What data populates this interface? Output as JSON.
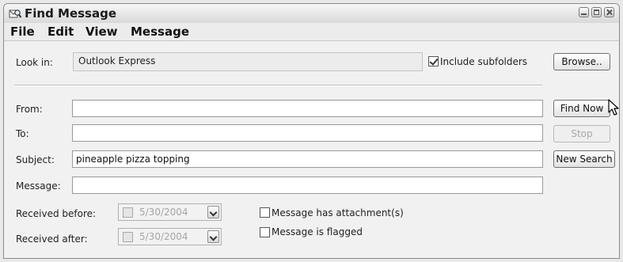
{
  "window": {
    "title": "Find Message",
    "icon": "find-message-icon"
  },
  "menu": [
    "File",
    "Edit",
    "View",
    "Message"
  ],
  "look_in": {
    "label": "Look in:",
    "value": "Outlook Express"
  },
  "include_subfolders": {
    "label": "Include subfolders",
    "checked": true
  },
  "buttons": {
    "browse": "Browse..",
    "find_now": "Find Now",
    "stop": "Stop",
    "new_search": "New Search"
  },
  "fields": {
    "from": {
      "label": "From:",
      "value": ""
    },
    "to": {
      "label": "To:",
      "value": ""
    },
    "subject": {
      "label": "Subject:",
      "value": "pineapple pizza topping"
    },
    "message": {
      "label": "Message:",
      "value": ""
    }
  },
  "received_before": {
    "label": "Received before:",
    "date": "5/30/2004",
    "checked": false
  },
  "received_after": {
    "label": "Received after:",
    "date": "5/30/2004",
    "checked": false
  },
  "has_attachments": {
    "label": "Message has attachment(s)",
    "checked": false
  },
  "is_flagged": {
    "label": "Message is flagged",
    "checked": false
  }
}
